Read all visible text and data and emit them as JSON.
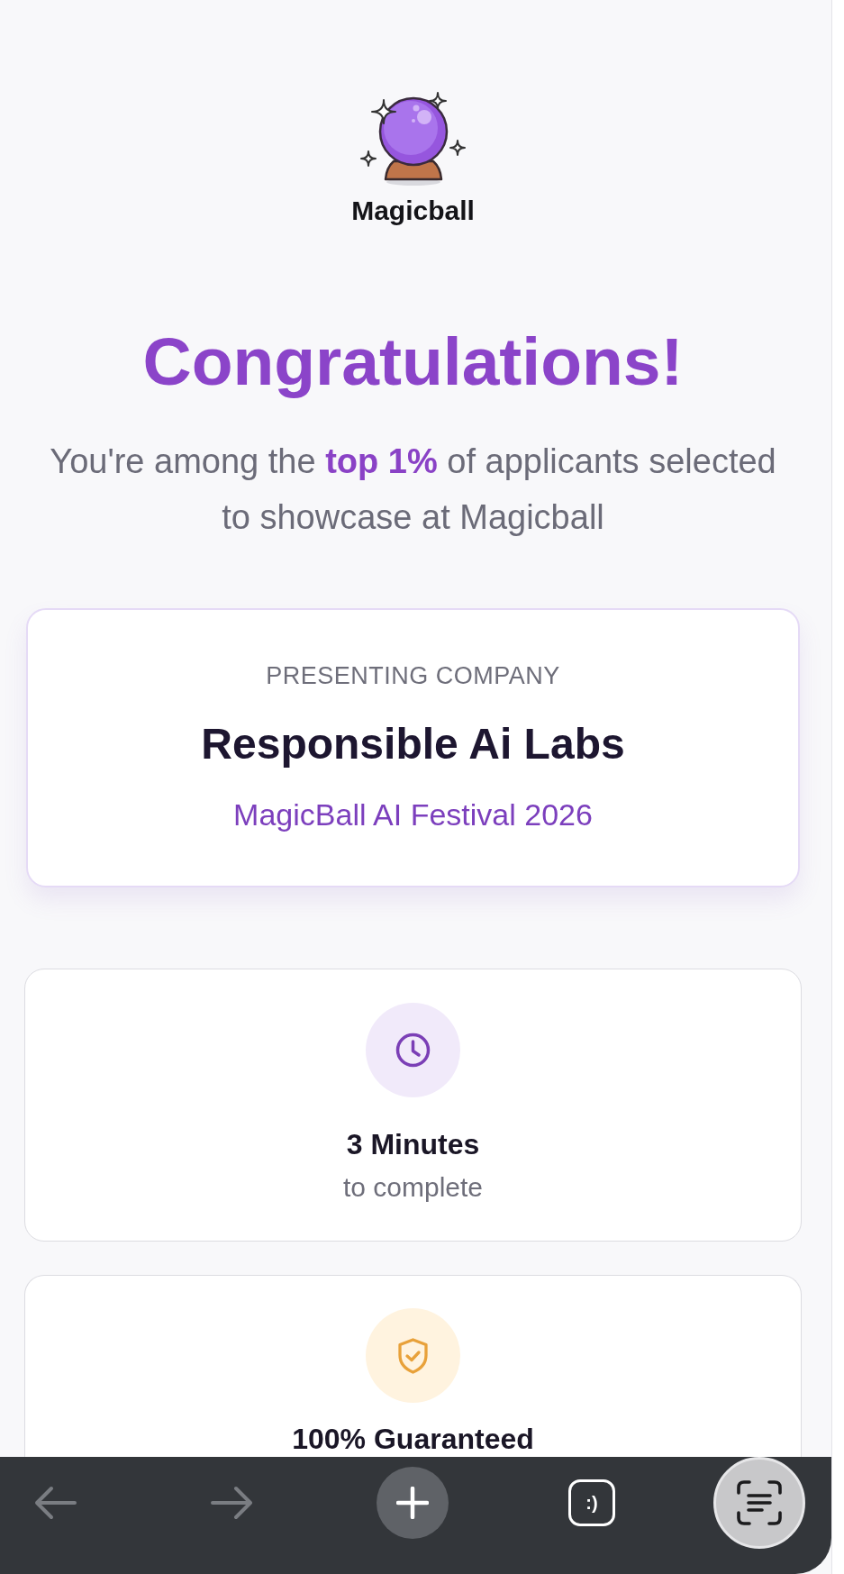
{
  "brand": {
    "name": "Magicball"
  },
  "heading": "Congratulations!",
  "subtitle": "You're among the **top 1%** of applicants selected to showcase at Magicball",
  "company_card": {
    "label": "PRESENTING COMPANY",
    "name": "Responsible Ai Labs",
    "event": "MagicBall AI Festival 2026"
  },
  "highlights": [
    {
      "kind": "clock",
      "title": "3 Minutes",
      "subtitle": "to complete"
    },
    {
      "kind": "shield",
      "title": "100% Guaranteed"
    }
  ],
  "toolbar": [
    {
      "kind": "back",
      "disabled": true
    },
    {
      "kind": "forward",
      "disabled": true
    },
    {
      "kind": "new_tab",
      "disabled": false
    },
    {
      "kind": "tabs",
      "label": ":)",
      "disabled": false
    },
    {
      "kind": "scan",
      "disabled": false
    }
  ]
}
